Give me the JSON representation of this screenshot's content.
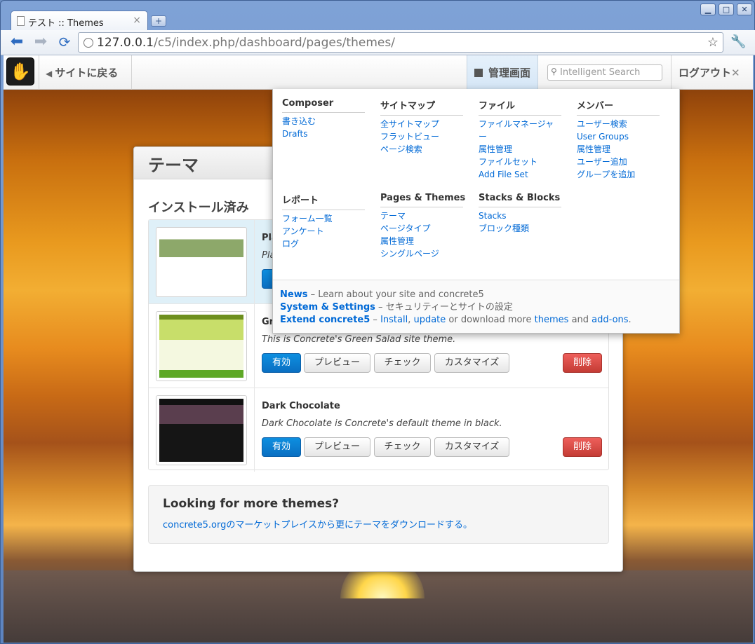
{
  "browser": {
    "tab_title": "テスト :: Themes",
    "url_host": "127.0.0.1",
    "url_path": "/c5/index.php/dashboard/pages/themes/"
  },
  "c5bar": {
    "back_label": "サイトに戻る",
    "dashboard_label": "管理画面",
    "search_placeholder": "Intelligent Search",
    "logout_label": "ログアウト"
  },
  "panel": {
    "title": "テーマ",
    "section_title": "インストール済み",
    "themes": [
      {
        "name": "Pla",
        "description": "Pla"
      },
      {
        "name": "Gre",
        "description": "This is Concrete's Green Salad site theme."
      },
      {
        "name": "Dark Chocolate",
        "description": "Dark Chocolate is Concrete's default theme in black."
      }
    ],
    "buttons": {
      "activate": "有効",
      "preview": "プレビュー",
      "inspect": "チェック",
      "customize": "カスタマイズ",
      "remove": "削除"
    },
    "more": {
      "heading": "Looking for more themes?",
      "link": "concrete5.orgのマーケットプレイスから更にテーマをダウンロードする。"
    }
  },
  "dashmenu": {
    "groups": [
      {
        "title": "Composer",
        "items": [
          "書き込む",
          "Drafts"
        ]
      },
      {
        "title": "サイトマップ",
        "items": [
          "全サイトマップ",
          "フラットビュー",
          "ページ検索"
        ]
      },
      {
        "title": "ファイル",
        "items": [
          "ファイルマネージャ",
          "ー",
          "属性管理",
          "ファイルセット",
          "Add File Set"
        ]
      },
      {
        "title": "メンバー",
        "items": [
          "ユーザー検索",
          "User Groups",
          "属性管理",
          "ユーザー追加",
          "グループを追加"
        ]
      },
      {
        "title": "レポート",
        "items": [
          "フォーム一覧",
          "アンケート",
          "ログ"
        ]
      },
      {
        "title": "Pages & Themes",
        "items": [
          "テーマ",
          "ページタイプ",
          "属性管理",
          "シングルページ"
        ]
      },
      {
        "title": "Stacks & Blocks",
        "items": [
          "Stacks",
          "ブロック種類"
        ]
      }
    ],
    "footer": {
      "news": "News",
      "news_text": " – Learn about your site and concrete5",
      "system": "System & Settings",
      "system_text": " – セキュリティーとサイトの設定",
      "extend": "Extend concrete5",
      "extend_dash": " – ",
      "install": "Install",
      "comma": ", ",
      "update": "update",
      "or_text": " or download more ",
      "themes": "themes",
      "and_text": " and ",
      "addons": "add-ons",
      "period": "."
    }
  }
}
